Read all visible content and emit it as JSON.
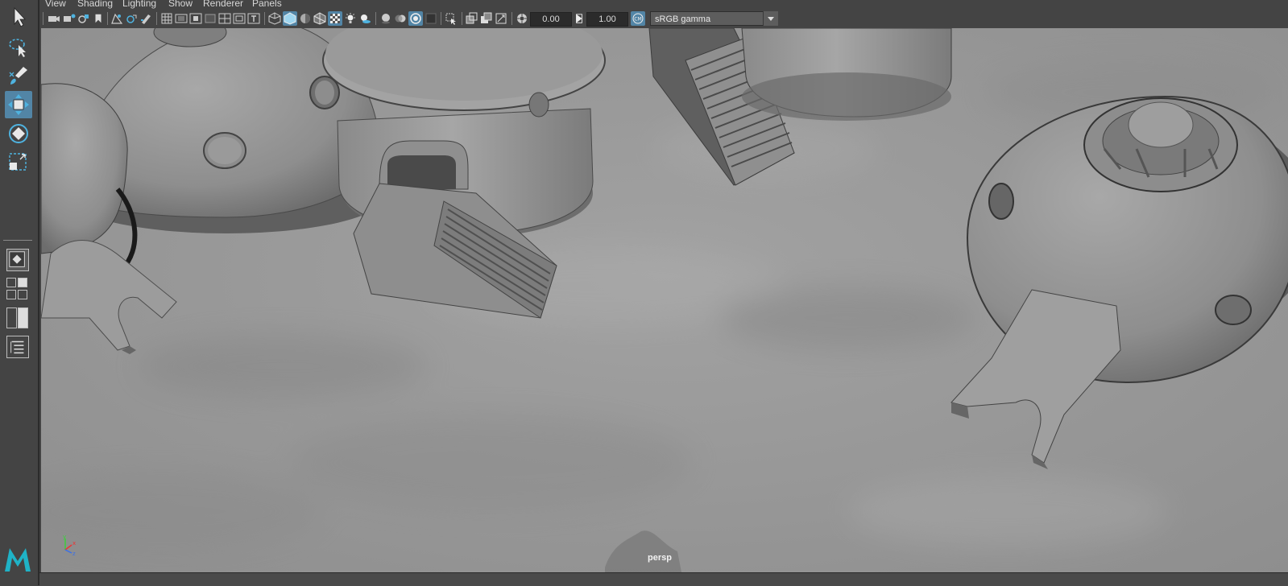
{
  "menubar": {
    "items": [
      "View",
      "Shading",
      "Lighting",
      "Show",
      "Renderer",
      "Panels"
    ]
  },
  "toolbar": {
    "exposure_value": "0.00",
    "gamma_value": "1.00",
    "color_space": "sRGB gamma"
  },
  "viewport": {
    "camera_label": "persp",
    "axis_labels": [
      "x",
      "y",
      "z"
    ]
  },
  "toolbox": {
    "tools": [
      "select-tool-icon",
      "lasso-tool-icon",
      "paint-select-tool-icon",
      "move-tool-icon",
      "rotate-tool-icon",
      "scale-tool-icon"
    ],
    "active_tool": "move-tool-icon"
  },
  "colors": {
    "accent": "#5285a6",
    "ui_background": "#444444",
    "viewport_background": "#9a9a9a"
  }
}
